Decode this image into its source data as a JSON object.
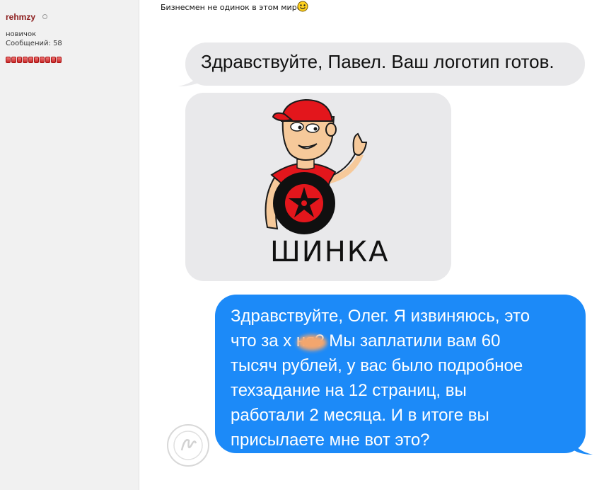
{
  "sidebar": {
    "username": "rehmzy",
    "rank": "новичок",
    "posts_label": "Сообщений:",
    "posts_count": "58",
    "reputation_pips": 10
  },
  "post": {
    "title": "Бизнесмен не одинок в этом мире",
    "title_emoji": "smiley-icon"
  },
  "chat": {
    "incoming_message": "Здравствуйте, Павел. Ваш логотип готов.",
    "logo_image": {
      "caption": "ШИНКА",
      "description_icon": "mascot-logo"
    },
    "outgoing_lines": [
      "Здравствуйте, Олег. Я извиняюсь, это",
      "что за х   ня? Мы заплатили вам 60",
      "тысяч рублей, у вас было подробное",
      "техзадание на 12 страниц, вы",
      "работали 2 месяца. И в итоге вы",
      "присылаете мне вот это?"
    ]
  },
  "colors": {
    "incoming_bubble": "#e9e9eb",
    "outgoing_bubble": "#1c8af8",
    "username": "#8b1c1c",
    "reputation": "#d23a3a"
  }
}
